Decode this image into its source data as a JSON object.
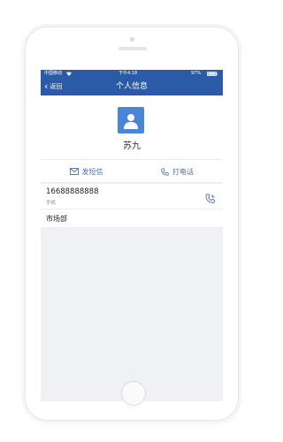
{
  "status_bar": {
    "carrier": "中国移动",
    "wifi_icon": "wifi-icon",
    "time": "下午4:18",
    "battery": "97%"
  },
  "nav": {
    "back_label": "返回",
    "title": "个人信息"
  },
  "profile": {
    "avatar_icon": "person-icon",
    "name": "苏九"
  },
  "actions": {
    "sms_label": "发短信",
    "sms_icon": "envelope-icon",
    "call_label": "打电话",
    "call_icon": "phone-icon"
  },
  "contact": {
    "phone_number": "16688888888",
    "phone_label": "手机",
    "department": "市场部"
  },
  "colors": {
    "header": "#2b5aa6",
    "accent": "#4a6fa8",
    "avatar": "#4a86d6",
    "background": "#f0f1f5"
  }
}
